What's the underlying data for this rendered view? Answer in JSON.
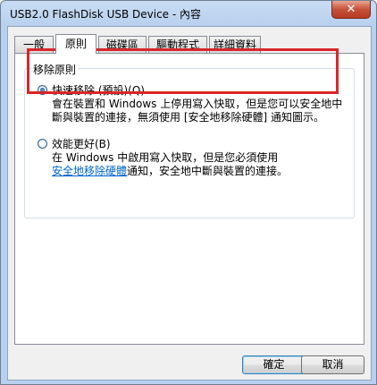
{
  "window": {
    "title": "USB2.0 FlashDisk USB Device - 內容",
    "close_label": "✕"
  },
  "tabs": [
    {
      "label": "一般",
      "active": false
    },
    {
      "label": "原則",
      "active": true
    },
    {
      "label": "磁碟區",
      "active": false
    },
    {
      "label": "驅動程式",
      "active": false
    },
    {
      "label": "詳細資料",
      "active": false
    }
  ],
  "removal_policy": {
    "group_label": "移除原則",
    "quick_removal": {
      "label": "快速移除 (預設)(Q)",
      "selected": true,
      "desc_line1": "會在裝置和 Windows 上停用寫入快取，但是您可以安全地中",
      "desc_line2": "斷與裝置的連接，無須使用 [安全地移除硬體] 通知圖示。"
    },
    "better_performance": {
      "label": "效能更好(B)",
      "selected": false,
      "desc_line1": "在 Windows 中啟用寫入快取，但是您必須使用",
      "desc_link": "安全地移除硬體",
      "desc_line2_rest": "通知，安全地中斷與裝置的連接。"
    },
    "highlight_color": "#d9262a"
  },
  "buttons": {
    "ok": "確定",
    "cancel": "取消"
  }
}
